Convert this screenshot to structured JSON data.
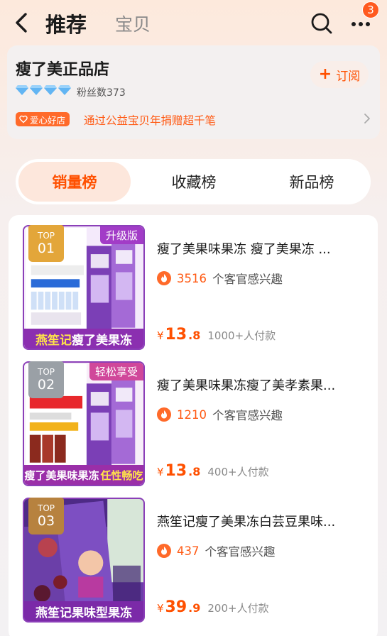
{
  "header": {
    "tab_active": "推荐",
    "tab_inactive": "宝贝",
    "notification_count": "3",
    "icons": [
      "back-arrow-icon",
      "search-icon",
      "more-icon"
    ]
  },
  "store": {
    "name": "瘦了美正品店",
    "fans_label": "粉丝数373",
    "follow_label": "订阅",
    "charity_tag": "爱心好店",
    "charity_text": "通过公益宝贝年捐赠超千笔",
    "diamond_count": 4,
    "colors": {
      "accent": "#ff5000",
      "diamond": "#62b5f3"
    }
  },
  "rank_tabs": [
    {
      "label": "销量榜",
      "active": true
    },
    {
      "label": "收藏榜",
      "active": false
    },
    {
      "label": "新品榜",
      "active": false
    }
  ],
  "products": [
    {
      "rank_top": "TOP",
      "rank_num": "01",
      "badge_color": "#e3a63a",
      "title": "瘦了美果味果冻 瘦了美果冻 ...",
      "interest_num": "3516",
      "interest_text": "个客官感兴趣",
      "currency": "¥",
      "price_int": "13",
      "price_dec": ".8",
      "sold": "1000+人付款",
      "thumb_banner": "升级版",
      "thumb_bottom_a": "燕笙记",
      "thumb_bottom_b": "瘦了美果冻"
    },
    {
      "rank_top": "TOP",
      "rank_num": "02",
      "badge_color": "#9aa0a6",
      "title": "瘦了美果味果冻瘦了美孝素果...",
      "interest_num": "1210",
      "interest_text": "个客官感兴趣",
      "currency": "¥",
      "price_int": "13",
      "price_dec": ".8",
      "sold": "400+人付款",
      "thumb_banner": "轻松享受",
      "thumb_bottom_a": "瘦了美果味果冻",
      "thumb_bottom_b": "任性畅吃"
    },
    {
      "rank_top": "TOP",
      "rank_num": "03",
      "badge_color": "#b7823f",
      "title": "燕笙记瘦了美果冻白芸豆果味...",
      "interest_num": "437",
      "interest_text": "个客官感兴趣",
      "currency": "¥",
      "price_int": "39",
      "price_dec": ".9",
      "sold": "200+人付款",
      "thumb_banner": "",
      "thumb_bottom_a": "燕笙记果味型果冻",
      "thumb_bottom_b": ""
    }
  ]
}
